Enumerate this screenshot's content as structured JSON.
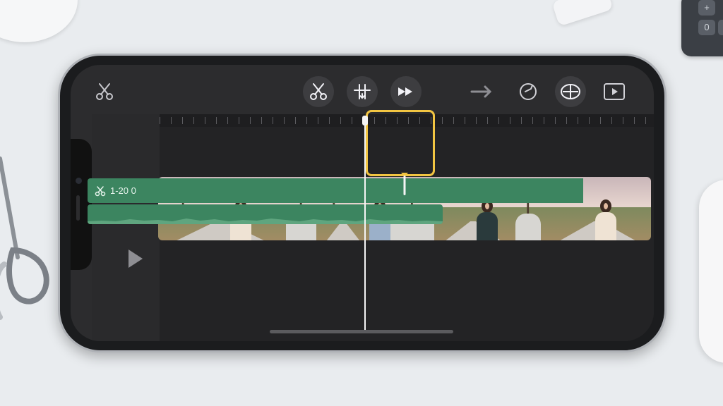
{
  "editor": {
    "title_track_label": "1-20 0"
  },
  "toolbar": {
    "items": [
      "scissors-icon",
      "split-icon",
      "detach-icon",
      "fast-forward-icon",
      "move-arrow-icon",
      "rotate-icon",
      "fit-icon",
      "preview-icon"
    ]
  },
  "calculator": {
    "keys": [
      "+",
      "0",
      "-"
    ]
  },
  "colors": {
    "accent_selection": "#f2c542",
    "track_green": "#3c8560",
    "background_dark": "#2c2c2e"
  }
}
